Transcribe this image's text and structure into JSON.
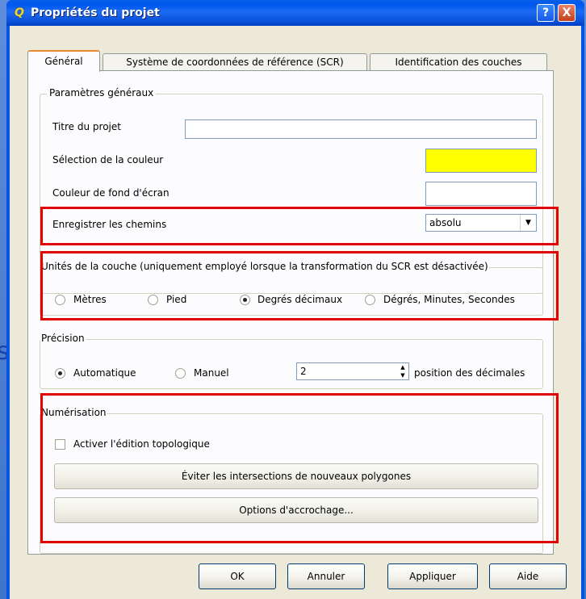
{
  "window": {
    "title": "Propriétés du projet",
    "app_icon": "Q",
    "help_label": "?",
    "close_label": "X"
  },
  "background": {
    "glyph": "s"
  },
  "tabs": [
    {
      "label": "Général",
      "active": true
    },
    {
      "label": "Système de coordonnées de référence (SCR)",
      "active": false
    },
    {
      "label": "Identification des couches",
      "active": false
    }
  ],
  "general_params": {
    "title": "Paramètres généraux",
    "project_title_label": "Titre du projet",
    "project_title_value": "",
    "color_selection_label": "Sélection de la couleur",
    "color_selection_value": "#ffff00",
    "background_color_label": "Couleur de fond d'écran",
    "background_color_value": "#ffffff",
    "save_paths_label": "Enregistrer les chemins",
    "save_paths_value": "absolu"
  },
  "layer_units": {
    "title": "Unités de la couche (uniquement employé lorsque la transformation du SCR est désactivée)",
    "options": [
      {
        "label": "Mètres",
        "selected": false
      },
      {
        "label": "Pied",
        "selected": false
      },
      {
        "label": "Degrés décimaux",
        "selected": true
      },
      {
        "label": "Dégrés, Minutes, Secondes",
        "selected": false
      }
    ]
  },
  "precision": {
    "title": "Précision",
    "automatic_label": "Automatique",
    "automatic_selected": true,
    "manual_label": "Manuel",
    "manual_selected": false,
    "decimal_places_value": "2",
    "decimal_places_suffix": "position des décimales"
  },
  "digitizing": {
    "title": "Numérisation",
    "topological_editing_label": "Activer l'édition topologique",
    "topological_editing_checked": false,
    "avoid_intersections_label": "Éviter les intersections de nouveaux polygones",
    "snapping_options_label": "Options d'accrochage..."
  },
  "buttons": {
    "ok": "OK",
    "cancel": "Annuler",
    "apply": "Appliquer",
    "help": "Aide"
  },
  "colors": {
    "highlight": "#e20000",
    "titlebar": "#0054e3",
    "dialog_bg": "#ece9d8",
    "yellow_swatch": "#ffff00"
  }
}
